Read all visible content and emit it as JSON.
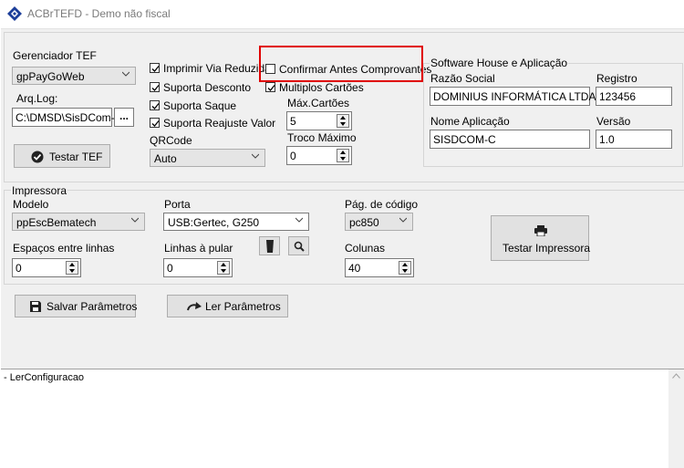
{
  "window": {
    "title": "ACBrTEFD - Demo não fiscal"
  },
  "tef": {
    "gerenciador_label": "Gerenciador TEF",
    "gerenciador_value": "gpPayGoWeb",
    "arqlog_label": "Arq.Log:",
    "arqlog_value": "C:\\DMSD\\SisDCom-C",
    "browse_label": "...",
    "testar_label": "Testar TEF",
    "imprimir_via_reduzida": "Imprimir Via Reduzida",
    "suporta_desconto": "Suporta Desconto",
    "suporta_saque": "Suporta Saque",
    "suporta_reajuste": "Suporta Reajuste Valor",
    "qrcode_label": "QRCode",
    "qrcode_value": "Auto",
    "confirmar_label": "Confirmar Antes Comprovantes",
    "multiplos_label": "Multiplos Cartões",
    "max_cartoes_label": "Máx.Cartões",
    "max_cartoes_value": "5",
    "troco_label": "Troco Máximo",
    "troco_value": "0"
  },
  "software_house": {
    "group_label": "Software House e Aplicação",
    "razao_label": "Razão Social",
    "razao_value": "DOMINIUS INFORMÁTICA LTDA.",
    "registro_label": "Registro",
    "registro_value": "123456",
    "nome_label": "Nome Aplicação",
    "nome_value": "SISDCOM-C",
    "versao_label": "Versão",
    "versao_value": "1.0"
  },
  "impressora": {
    "group_label": "Impressora",
    "modelo_label": "Modelo",
    "modelo_value": "ppEscBematech",
    "porta_label": "Porta",
    "porta_value": "USB:Gertec, G250",
    "pag_codigo_label": "Pág. de código",
    "pag_codigo_value": "pc850",
    "espacos_label": "Espaços entre linhas",
    "espacos_value": "0",
    "linhas_label": "Linhas à pular",
    "linhas_value": "0",
    "colunas_label": "Colunas",
    "colunas_value": "40",
    "testar_label": "Testar Impressora"
  },
  "actions": {
    "salvar_label": "Salvar Parâmetros",
    "ler_label": "Ler Parâmetros"
  },
  "log": {
    "lines": [
      "- LerConfiguracao"
    ]
  }
}
